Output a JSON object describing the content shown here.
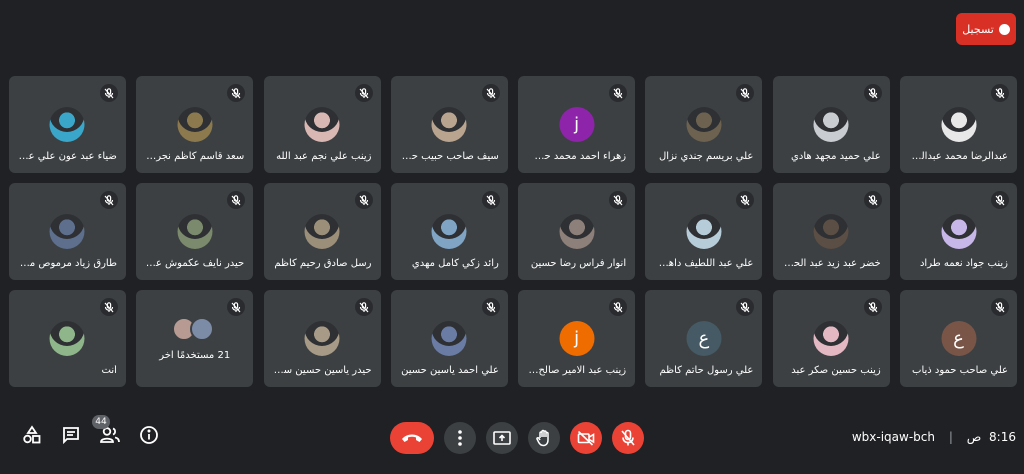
{
  "recording": {
    "label": "تسجيل",
    "color": "#d93025"
  },
  "participants": [
    {
      "name": "عبدالرضا محمد عبدالرضا",
      "avatar": "photo",
      "color": "#e8e8e8"
    },
    {
      "name": "علي حميد مجهد هادي",
      "avatar": "photo",
      "color": "#c9cdd2"
    },
    {
      "name": "علي بريسم جندي نزال",
      "avatar": "photo",
      "color": "#6d6250"
    },
    {
      "name": "زهراء احمد محمد حسين",
      "avatar": "letter",
      "letter": "j",
      "color": "#8e24aa"
    },
    {
      "name": "سيف صاحب حبيب حسين",
      "avatar": "photo",
      "color": "#b9a58f"
    },
    {
      "name": "زينب علي نجم عبد الله",
      "avatar": "photo",
      "color": "#d9b8b4"
    },
    {
      "name": "سعد قاسم كاظم نجرس",
      "avatar": "photo",
      "color": "#8c7a4e"
    },
    {
      "name": "ضياء عبد عون علي عب...",
      "avatar": "photo",
      "color": "#3aa6c9"
    },
    {
      "name": "زينب جواد نعمه طراد",
      "avatar": "photo",
      "color": "#c7b6e8"
    },
    {
      "name": "خضر عبد زيد عبد الحس...",
      "avatar": "photo",
      "color": "#5b4e44"
    },
    {
      "name": "علي عبد اللطيف داهي ...",
      "avatar": "photo",
      "color": "#b7ccd9"
    },
    {
      "name": "انوار فراس رضا حسين",
      "avatar": "photo",
      "color": "#8d7f79"
    },
    {
      "name": "رائد زكي كامل مهدي",
      "avatar": "photo",
      "color": "#7fa4c4"
    },
    {
      "name": "رسل صادق رحيم كاظم",
      "avatar": "photo",
      "color": "#9c8f7a"
    },
    {
      "name": "حيدر نايف عكموش عيدان",
      "avatar": "photo",
      "color": "#7b8a6c"
    },
    {
      "name": "طارق زياد مرموص مت...",
      "avatar": "photo",
      "color": "#5d6f8c"
    },
    {
      "name": "علي صاحب حمود ذياب",
      "avatar": "letter",
      "letter": "ع",
      "color": "#795548"
    },
    {
      "name": "زينب حسين صكر عبد",
      "avatar": "photo",
      "color": "#e3b8c2"
    },
    {
      "name": "علي رسول حاتم كاظم",
      "avatar": "letter",
      "letter": "ع",
      "color": "#455a64"
    },
    {
      "name": "زينب عبد الامير صالح ...",
      "avatar": "letter",
      "letter": "j",
      "color": "#ef6c00"
    },
    {
      "name": "علي احمد ياسين حسين",
      "avatar": "photo",
      "color": "#6a7ca3"
    },
    {
      "name": "حيدر ياسين حسين سياح",
      "avatar": "photo",
      "color": "#a79a86"
    },
    {
      "name": "21 مستخدمًا آخر",
      "avatar": "stack",
      "color": "#b79b93"
    },
    {
      "name": "أنت",
      "avatar": "photo",
      "color": "#8fb58a"
    }
  ],
  "footer": {
    "people_count": "44",
    "meeting_code": "wbx-iqaw-bch",
    "time": "8:16",
    "time_period": "ص",
    "separator": "|"
  },
  "colors": {
    "background": "#202124",
    "tile": "#3c4043",
    "danger": "#ea4335"
  }
}
